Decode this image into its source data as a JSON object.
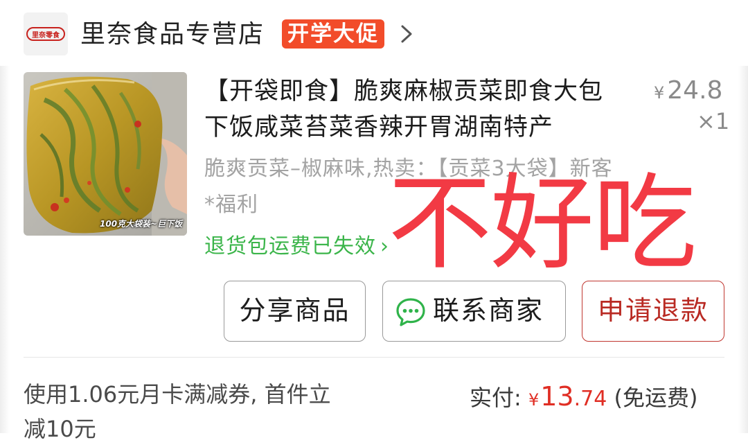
{
  "store": {
    "logo_text": "里奈零食",
    "name": "里奈食品专营店",
    "promo_badge": "开学大促",
    "chevron_icon": "chevron-right-icon"
  },
  "product": {
    "image_caption": "100克大袋装~巨下饭",
    "title": "【开袋即食】脆爽麻椒贡菜即食大包下饭咸菜苔菜香辣开胃湖南特产",
    "price_symbol": "¥",
    "price": "24.8",
    "quantity": "×1",
    "spec": "脆爽贡菜–椒麻味,热卖：【贡菜3大袋】新客*福利",
    "return_status": "退货包运费已失效",
    "return_chevron": "›"
  },
  "overlay_handwriting": "不好吃",
  "actions": {
    "share_label": "分享商品",
    "contact_label": "联系商家",
    "refund_label": "申请退款"
  },
  "footer": {
    "coupon_text": "使用1.06元月卡满减券, 首件立减10元",
    "paid_label": "实付:",
    "paid_symbol": "¥",
    "paid_int": "13",
    "paid_dec": ".74",
    "shipping_note": "(免运费)"
  },
  "colors": {
    "promo_badge": "#f24c2a",
    "return_status": "#3bb54a",
    "refund_button": "#b92a23",
    "paid_amount": "#e02e24",
    "handwriting": "#f23a44"
  }
}
